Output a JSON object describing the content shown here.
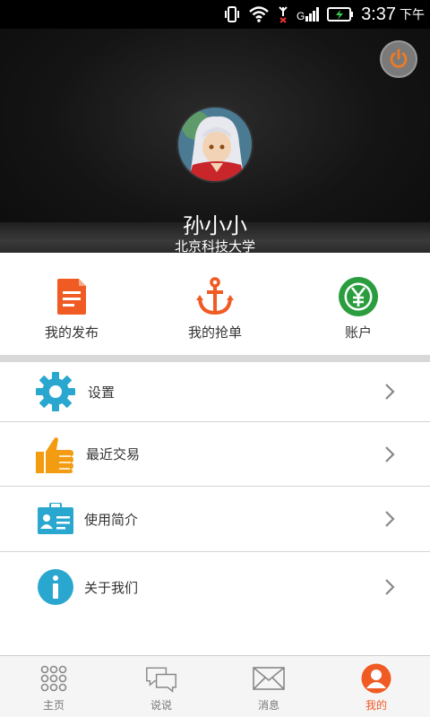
{
  "status_bar": {
    "time": "3:37",
    "ampm": "下午"
  },
  "profile": {
    "name": "孙小小",
    "school": "北京科技大学"
  },
  "quick_actions": [
    {
      "label": "我的发布",
      "icon": "document-icon"
    },
    {
      "label": "我的抢单",
      "icon": "anchor-icon"
    },
    {
      "label": "账户",
      "icon": "yuan-coin-icon"
    }
  ],
  "menu": [
    {
      "label": "设置",
      "icon": "gear-icon"
    },
    {
      "label": "最近交易",
      "icon": "thumbs-up-icon"
    },
    {
      "label": "使用简介",
      "icon": "id-card-icon"
    },
    {
      "label": "关于我们",
      "icon": "info-icon"
    }
  ],
  "bottom_nav": [
    {
      "label": "主页",
      "icon": "grid-dots-icon",
      "active": false
    },
    {
      "label": "说说",
      "icon": "chat-bubbles-icon",
      "active": false
    },
    {
      "label": "消息",
      "icon": "mail-icon",
      "active": false
    },
    {
      "label": "我的",
      "icon": "user-icon",
      "active": true
    }
  ],
  "colors": {
    "accent": "#f05a23",
    "blue": "#2aa7cf",
    "green": "#2a9d3f",
    "orange": "#f39c12"
  }
}
